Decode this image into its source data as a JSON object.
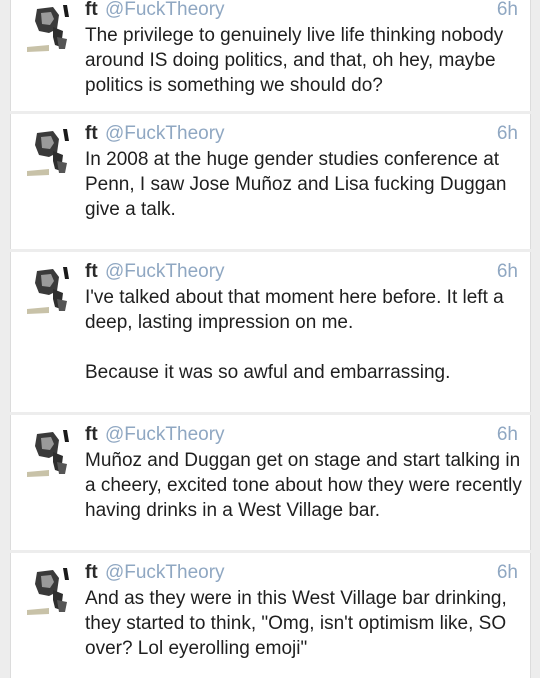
{
  "feed": {
    "tweets": [
      {
        "name": "ft",
        "handle": "@FuckTheory",
        "time": "6h",
        "paragraphs": [
          "The privilege to genuinely live life thinking nobody around IS doing politics, and that, oh hey, maybe politics is something we should do?"
        ]
      },
      {
        "name": "ft",
        "handle": "@FuckTheory",
        "time": "6h",
        "paragraphs": [
          "In 2008 at the huge gender studies conference at Penn, I saw Jose Muñoz and Lisa fucking Duggan give a talk."
        ]
      },
      {
        "name": "ft",
        "handle": "@FuckTheory",
        "time": "6h",
        "paragraphs": [
          "I've talked about that moment here before. It left a deep, lasting impression on me.",
          "Because it was so awful and embarrassing."
        ]
      },
      {
        "name": "ft",
        "handle": "@FuckTheory",
        "time": "6h",
        "paragraphs": [
          "Muñoz and Duggan get on stage and start talking in a cheery, excited tone about how they were recently having drinks in a West Village bar."
        ]
      },
      {
        "name": "ft",
        "handle": "@FuckTheory",
        "time": "6h",
        "paragraphs": [
          "And as they were in this West Village bar drinking, they started to think, \"Omg, isn't optimism like, SO over? Lol eyerolling emoji\""
        ]
      }
    ]
  }
}
